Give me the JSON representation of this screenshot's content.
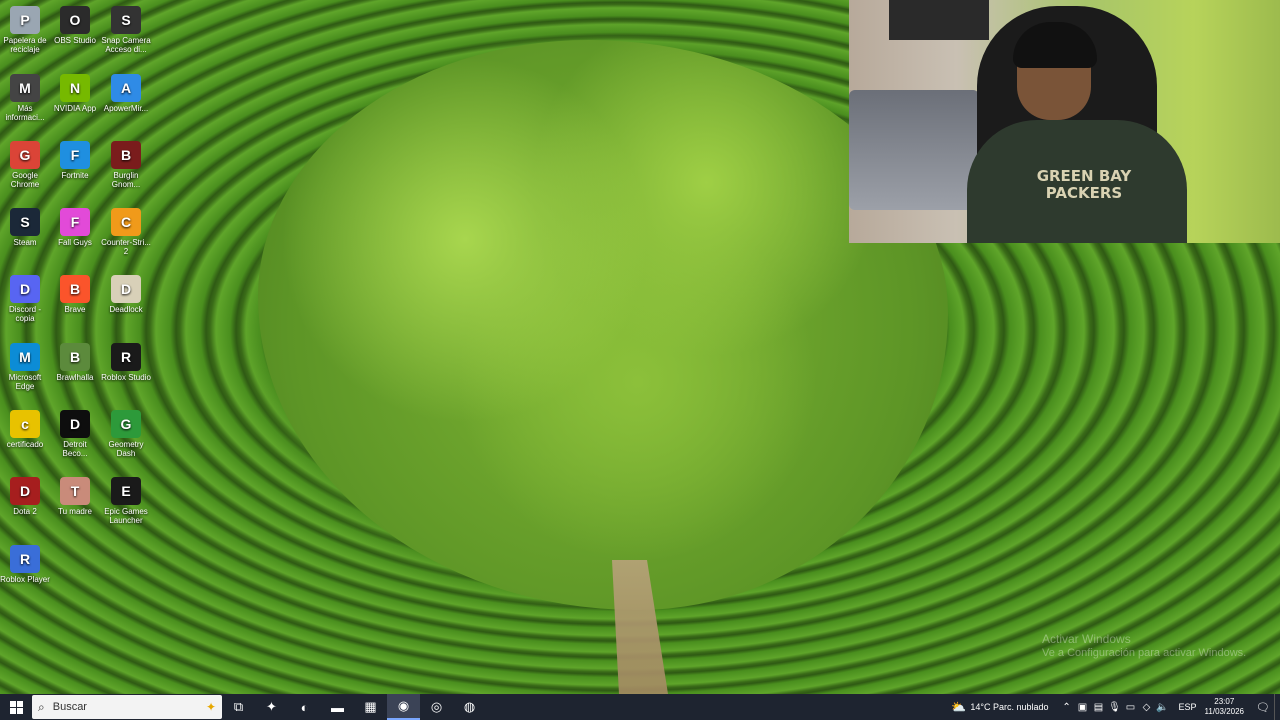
{
  "desktop": {
    "icons": [
      {
        "label": "Papelera de reciclaje",
        "icon": "recycle-bin-icon",
        "color": "#9aa6b2"
      },
      {
        "label": "OBS Studio",
        "icon": "obs-icon",
        "color": "#2b2b2b"
      },
      {
        "label": "Snap Camera Acceso di...",
        "icon": "snap-camera-icon",
        "color": "#333333"
      },
      {
        "label": "Más informaci...",
        "icon": "info-icon",
        "color": "#444444"
      },
      {
        "label": "NVIDIA App",
        "icon": "nvidia-icon",
        "color": "#76b900"
      },
      {
        "label": "ApowerMir...",
        "icon": "apowermirror-icon",
        "color": "#2f8be6"
      },
      {
        "label": "Google Chrome",
        "icon": "chrome-icon",
        "color": "#db4437"
      },
      {
        "label": "Fortnite",
        "icon": "fortnite-icon",
        "color": "#1f8fe0"
      },
      {
        "label": "Burglin Gnom...",
        "icon": "burglin-gnomes-icon",
        "color": "#7a1c1c"
      },
      {
        "label": "Steam",
        "icon": "steam-icon",
        "color": "#1b2838"
      },
      {
        "label": "Fall Guys",
        "icon": "fall-guys-icon",
        "color": "#e24ad8"
      },
      {
        "label": "Counter-Stri... 2",
        "icon": "counter-strike-icon",
        "color": "#f09a1a"
      },
      {
        "label": "Discord - copia",
        "icon": "discord-icon",
        "color": "#5865f2"
      },
      {
        "label": "Brave",
        "icon": "brave-icon",
        "color": "#fb542b"
      },
      {
        "label": "Deadlock",
        "icon": "deadlock-icon",
        "color": "#d8d0b8"
      },
      {
        "label": "Microsoft Edge",
        "icon": "edge-icon",
        "color": "#0c8cd6"
      },
      {
        "label": "Brawlhalla",
        "icon": "brawlhalla-icon",
        "color": "#5c8a3c"
      },
      {
        "label": "Roblox Studio",
        "icon": "roblox-studio-icon",
        "color": "#1a1a1a"
      },
      {
        "label": "certificado",
        "icon": "certificate-file-icon",
        "color": "#e8c200"
      },
      {
        "label": "Detroit Beco...",
        "icon": "detroit-icon",
        "color": "#0e0e0e"
      },
      {
        "label": "Geometry Dash",
        "icon": "geometry-dash-icon",
        "color": "#2d9a3a"
      },
      {
        "label": "Dota 2",
        "icon": "dota2-icon",
        "color": "#a61e1e"
      },
      {
        "label": "Tu madre",
        "icon": "image-file-icon",
        "color": "#c98b7a"
      },
      {
        "label": "Epic Games Launcher",
        "icon": "epic-games-icon",
        "color": "#1a1a1a"
      },
      {
        "label": "Roblox Player",
        "icon": "roblox-player-icon",
        "color": "#3a6ed8"
      }
    ]
  },
  "webcam": {
    "shirt_text": "GREEN BAY PACKERS"
  },
  "watermark": {
    "title": "Activar Windows",
    "subtitle": "Ve a Configuración para activar Windows."
  },
  "taskbar": {
    "search_placeholder": "Buscar",
    "apps": [
      {
        "name": "task-view-icon",
        "glyph": "⧉"
      },
      {
        "name": "copilot-icon",
        "glyph": "✦"
      },
      {
        "name": "edge-taskbar-icon",
        "glyph": "◐"
      },
      {
        "name": "file-explorer-icon",
        "glyph": "▬"
      },
      {
        "name": "store-icon",
        "glyph": "▦"
      },
      {
        "name": "discord-taskbar-icon",
        "glyph": "◉"
      },
      {
        "name": "chrome-taskbar-icon",
        "glyph": "◎"
      },
      {
        "name": "obs-taskbar-icon",
        "glyph": "◍"
      }
    ],
    "weather": "14°C  Parc. nublado",
    "lang": "ESP",
    "time": "23:07",
    "date": "11/03/2026"
  }
}
